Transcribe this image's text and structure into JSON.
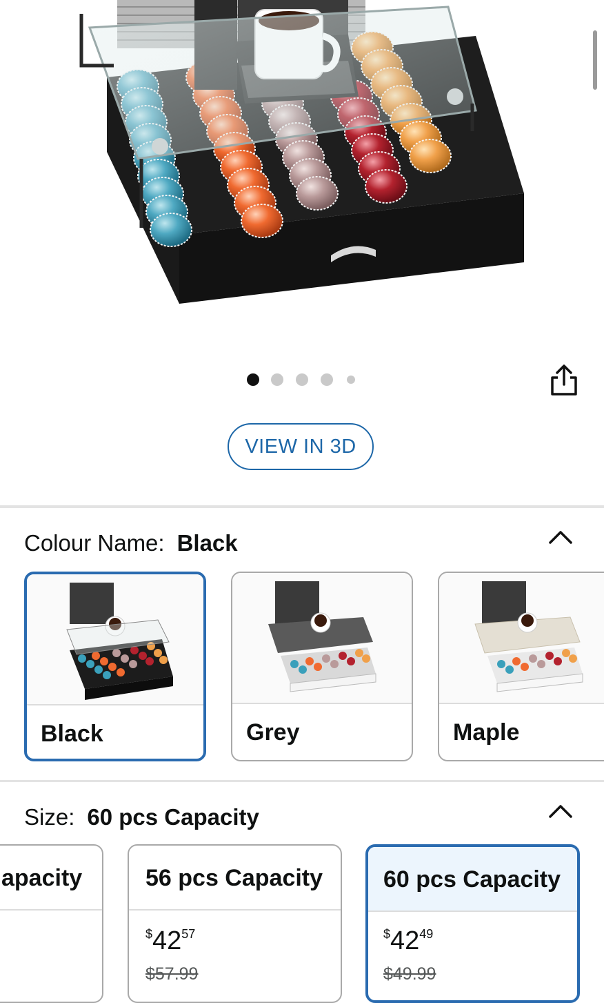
{
  "gallery": {
    "image_alt": "Coffee pod storage drawer with glass top in black, holding Vertuo capsules under a coffee machine",
    "dot_count": 5,
    "active_dot": 0
  },
  "buttons": {
    "view_3d": "VIEW IN 3D",
    "share_icon": "share-icon"
  },
  "colour": {
    "label": "Colour Name:",
    "selected": "Black",
    "options": [
      {
        "name": "Black",
        "selected": true
      },
      {
        "name": "Grey",
        "selected": false
      },
      {
        "name": "Maple",
        "selected": false
      }
    ]
  },
  "size": {
    "label": "Size:",
    "selected": "60 pcs Capacity",
    "options": [
      {
        "name": "apacity",
        "price": null,
        "was": null,
        "selected": false
      },
      {
        "name": "56 pcs Capacity",
        "price": {
          "symbol": "$",
          "whole": "42",
          "fraction": "57"
        },
        "was": "$57.99",
        "selected": false
      },
      {
        "name": "60 pcs Capacity",
        "price": {
          "symbol": "$",
          "whole": "42",
          "fraction": "49"
        },
        "was": "$49.99",
        "selected": true
      }
    ]
  },
  "colors": {
    "accent_blue": "#2a6bb0",
    "link_blue": "#1d67a8",
    "selected_header_bg": "#ecf5fd",
    "text": "#0f1111",
    "muted": "#565959"
  }
}
